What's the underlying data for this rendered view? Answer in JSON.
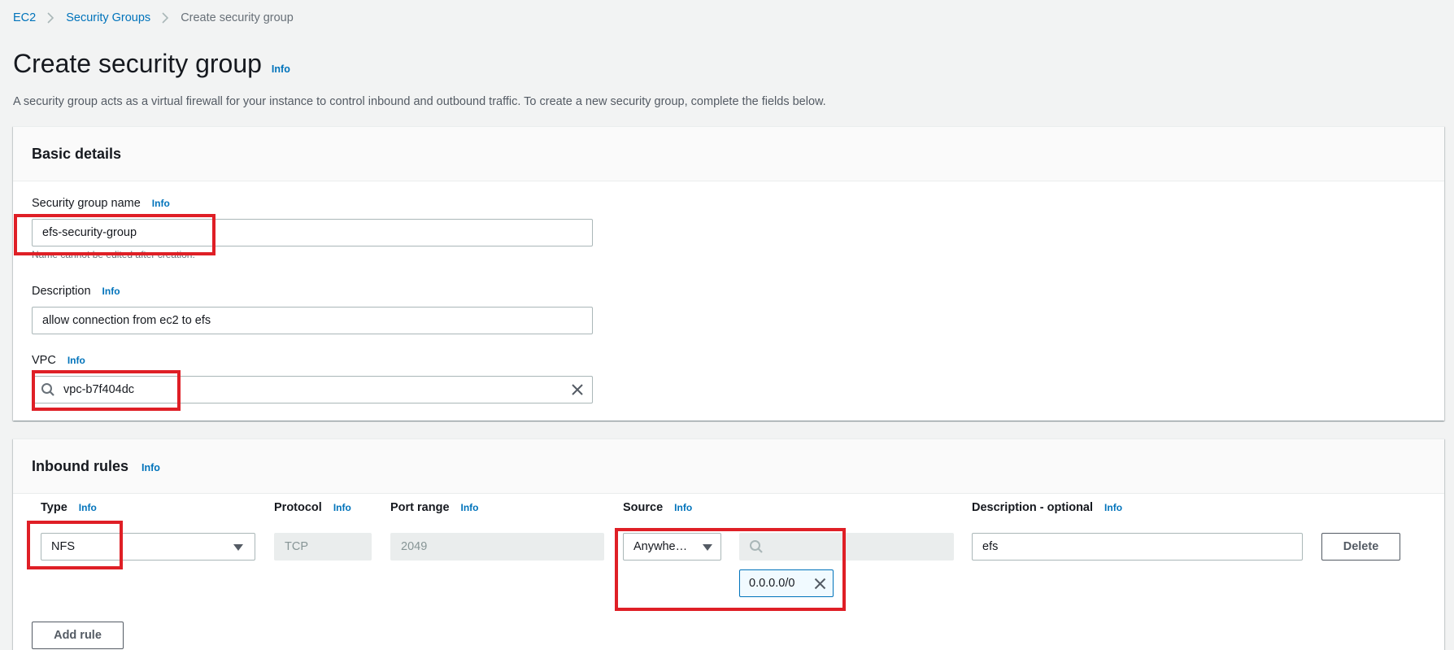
{
  "breadcrumb": {
    "items": [
      {
        "label": "EC2"
      },
      {
        "label": "Security Groups"
      }
    ],
    "current": "Create security group"
  },
  "page": {
    "title": "Create security group",
    "info_label": "Info",
    "description": "A security group acts as a virtual firewall for your instance to control inbound and outbound traffic. To create a new security group, complete the fields below."
  },
  "basic_details": {
    "title": "Basic details",
    "name": {
      "label": "Security group name",
      "info": "Info",
      "value": "efs-security-group",
      "hint": "Name cannot be edited after creation."
    },
    "description": {
      "label": "Description",
      "info": "Info",
      "value": "allow connection from ec2 to efs"
    },
    "vpc": {
      "label": "VPC",
      "info": "Info",
      "value": "vpc-b7f404dc",
      "icon": "search-icon",
      "clear_icon": "close-icon"
    }
  },
  "inbound_rules": {
    "title": "Inbound rules",
    "info": "Info",
    "columns": {
      "type": "Type",
      "protocol": "Protocol",
      "port_range": "Port range",
      "source": "Source",
      "description": "Description - optional"
    },
    "rules": [
      {
        "type": "NFS",
        "protocol": "TCP",
        "port_range": "2049",
        "source_type": "Anywhe…",
        "source_search_placeholder": "",
        "source_tokens": [
          "0.0.0.0/0"
        ],
        "description": "efs",
        "delete_label": "Delete"
      }
    ],
    "add_rule_label": "Add rule"
  },
  "colors": {
    "link": "#0073bb",
    "highlight": "#df1f26",
    "background": "#f2f3f3"
  }
}
